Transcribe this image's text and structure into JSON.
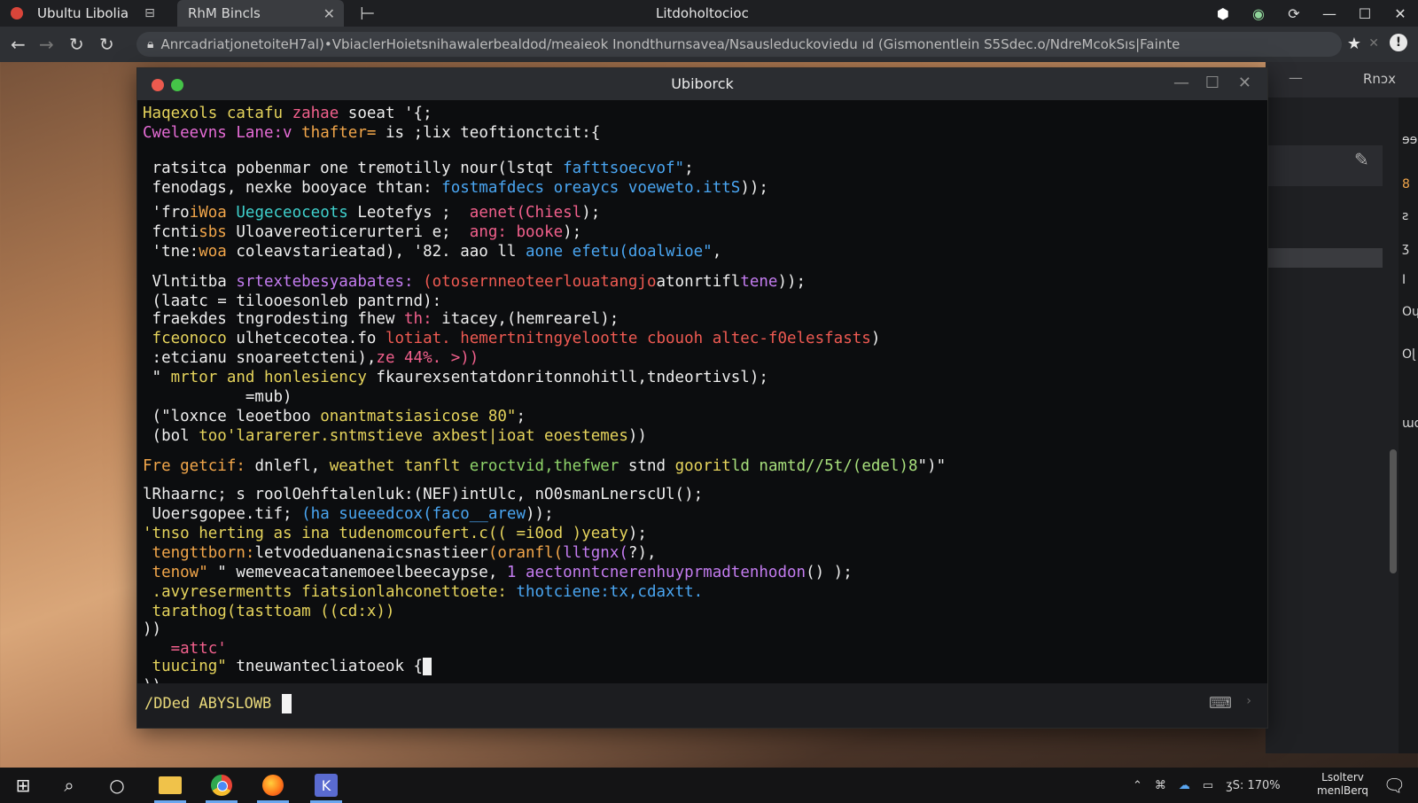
{
  "browser": {
    "tabs": [
      {
        "label": "Ubultu Libolia",
        "icon": "tab-grid-icon"
      },
      {
        "label": "RhM Bincls"
      }
    ],
    "window_title": "Litdoholtocioc",
    "url": "AnrcadriatjonetoiteH7al)•VbiaclerHoietsnihawalerbealdod/meaieok Inondthurnsavea/Nsausleduckoviedu ıd (Gismonentlein S5Sdec.o/NdreMcokSıs|Fainte"
  },
  "background_panel": {
    "title": "Rnɔx",
    "side_icons": [
      "ɘɘɑ",
      "8",
      "ƨ",
      "ʒ",
      "I",
      "Οɥ",
      "Οɭ",
      "ɯɑɭ"
    ]
  },
  "terminal": {
    "title": "Ubiborck",
    "lines": [
      [
        [
          "Haqexols catafu ",
          "ye"
        ],
        [
          "zahae",
          "pk"
        ],
        [
          " soeat '{;",
          "wh"
        ]
      ],
      [
        [
          "Cweleevns Lane:v ",
          "mg"
        ],
        [
          "thafter=",
          "or"
        ],
        [
          " is ;lix teoftionctcit:{",
          "wh"
        ]
      ],
      [
        [
          " ratsitca pobenmar one tremotilly nour(lstqt ",
          "wh"
        ],
        [
          "fafttsoecvof\"",
          "bl"
        ],
        [
          ";",
          "wh"
        ]
      ],
      [
        [
          " fenodags, nexke booyace thtan: ",
          "wh"
        ],
        [
          "fostmafdecs oreaycs voeweto.ittS",
          "bl"
        ],
        [
          "));",
          "wh"
        ]
      ],
      [
        [
          " 'fro",
          "wh"
        ],
        [
          "iWoa ",
          "or"
        ],
        [
          "Uegeceoceots ",
          "cy"
        ],
        [
          "Leotefys ;  ",
          "wh"
        ],
        [
          "aenet(Chiesl",
          "pk"
        ],
        [
          ");",
          "wh"
        ]
      ],
      [
        [
          " fcnti",
          "wh"
        ],
        [
          "sbs ",
          "or"
        ],
        [
          "Uloavereoticerurteri e;  ",
          "wh"
        ],
        [
          "ang: booke",
          "pk"
        ],
        [
          ");",
          "wh"
        ]
      ],
      [
        [
          " 'tne:",
          "wh"
        ],
        [
          "woa ",
          "or"
        ],
        [
          "coleavstarieatad), '82. aao ll ",
          "wh"
        ],
        [
          "aone efetu(doalwioe\"",
          "bl"
        ],
        [
          ",",
          "wh"
        ]
      ],
      [
        [
          " Vlntitba ",
          "wh"
        ],
        [
          "srtextebesyaabates: ",
          "pu"
        ],
        [
          "(otosernneoteerlouatangjo",
          "rd"
        ],
        [
          "atonrtifl",
          "wh"
        ],
        [
          "tene",
          "pu"
        ],
        [
          "));",
          "wh"
        ]
      ],
      [
        [
          " (laatc = tilooesonleb pantrnd):",
          "wh"
        ]
      ],
      [
        [
          " fraekdes tngrodesting fhew ",
          "wh"
        ],
        [
          "th:",
          "pk"
        ],
        [
          " itacey,(hemrearel);",
          "wh"
        ]
      ],
      [
        [
          " fceonoco ",
          "ye"
        ],
        [
          "ulhetcecotea.fo ",
          "wh"
        ],
        [
          "lotiat. hemertnitngyelootte cbouoh altec-f0elesfasts",
          "rd"
        ],
        [
          ")",
          "wh"
        ]
      ],
      [
        [
          " :etcianu snoareetcteni),",
          "wh"
        ],
        [
          "ze 44%. >))",
          "pk"
        ]
      ],
      [
        [
          " \" ",
          "wh"
        ],
        [
          "mrtor and honlesiency ",
          "ye"
        ],
        [
          "fkaurexsentatdonritonnohitll,tndeortivsl);",
          "wh"
        ]
      ],
      [
        [
          "           =mub)",
          "wh"
        ]
      ],
      [
        [
          " (\"loxnce leoetboo ",
          "wh"
        ],
        [
          "onantmatsiasicose 80\"",
          "ye"
        ],
        [
          ";",
          "wh"
        ]
      ],
      [
        [
          " (bol ",
          "wh"
        ],
        [
          "too'lararerer.sntmstieve axbest|ioat eoestemes",
          "ye"
        ],
        [
          "))",
          "wh"
        ]
      ],
      [
        [
          "Fre getcif: ",
          "or"
        ],
        [
          "dnlefl, ",
          "wh"
        ],
        [
          "weathet tanflt ",
          "ye"
        ],
        [
          "eroctvid,thefwer ",
          "gr"
        ],
        [
          "stnd ",
          "wh"
        ],
        [
          "goorit",
          "ye"
        ],
        [
          "ld namtd//5t/(edel)8",
          "lg"
        ],
        [
          "\")\"",
          "wh"
        ]
      ],
      [
        [
          "lRhaarnc; s roolOehftalenluk:(NEF)",
          "wh"
        ],
        [
          "intUlc, nO0smanLnerscUl();",
          "wh"
        ]
      ],
      [
        [
          " Uoersgopee.tif; ",
          "wh"
        ],
        [
          "(ha sueeedcox(faco__arew",
          "bl"
        ],
        [
          "));",
          "wh"
        ]
      ],
      [
        [
          "'tnso herting as ina ",
          "ye"
        ],
        [
          "tudenomcoufert.c(( =i0od )yeaty",
          "ye"
        ],
        [
          ");",
          "wh"
        ]
      ],
      [
        [
          " tengttborn:",
          "or"
        ],
        [
          "letvodeduanenaicsnastieer",
          "wh"
        ],
        [
          "(oranfl(",
          "or"
        ],
        [
          "lltgnx(",
          "pu"
        ],
        [
          "?),",
          "wh"
        ]
      ],
      [
        [
          " tenow\" ",
          "or"
        ],
        [
          "\" wemeveacatanemoeel",
          "wh"
        ],
        [
          "beecaypse, ",
          "wh"
        ],
        [
          "1 aectonntcnerenhuyprmadtenhodon",
          "pu"
        ],
        [
          "() );",
          "wh"
        ]
      ],
      [
        [
          " .avyresermentts ",
          "ye"
        ],
        [
          "fiatsionlahconettoete: ",
          "ye"
        ],
        [
          "thotciene:tx,cdaxtt.",
          "bl"
        ]
      ],
      [
        [
          " tarathog(tasttoam ((cd:x))",
          "ye"
        ]
      ],
      [
        [
          "))",
          "wh"
        ]
      ],
      [
        [
          "   =attc'",
          "pk"
        ]
      ],
      [
        [
          " tuucing\" ",
          "ye"
        ],
        [
          "tneuwantecliatoeok {",
          "wh"
        ],
        [
          "",
          "cursor"
        ]
      ],
      [
        [
          "))",
          "wh"
        ]
      ]
    ],
    "prompt": "/DDed ABYSLOWB"
  },
  "taskbar": {
    "apps": [
      "start-icon",
      "search-icon",
      "task-view-icon",
      "file-explorer-icon",
      "chrome-icon",
      "firefox-icon",
      "krita-icon"
    ],
    "tray_text": "ʒS: 170%",
    "clock_line1": "Lsolterv",
    "clock_line2": "menlBerq"
  }
}
